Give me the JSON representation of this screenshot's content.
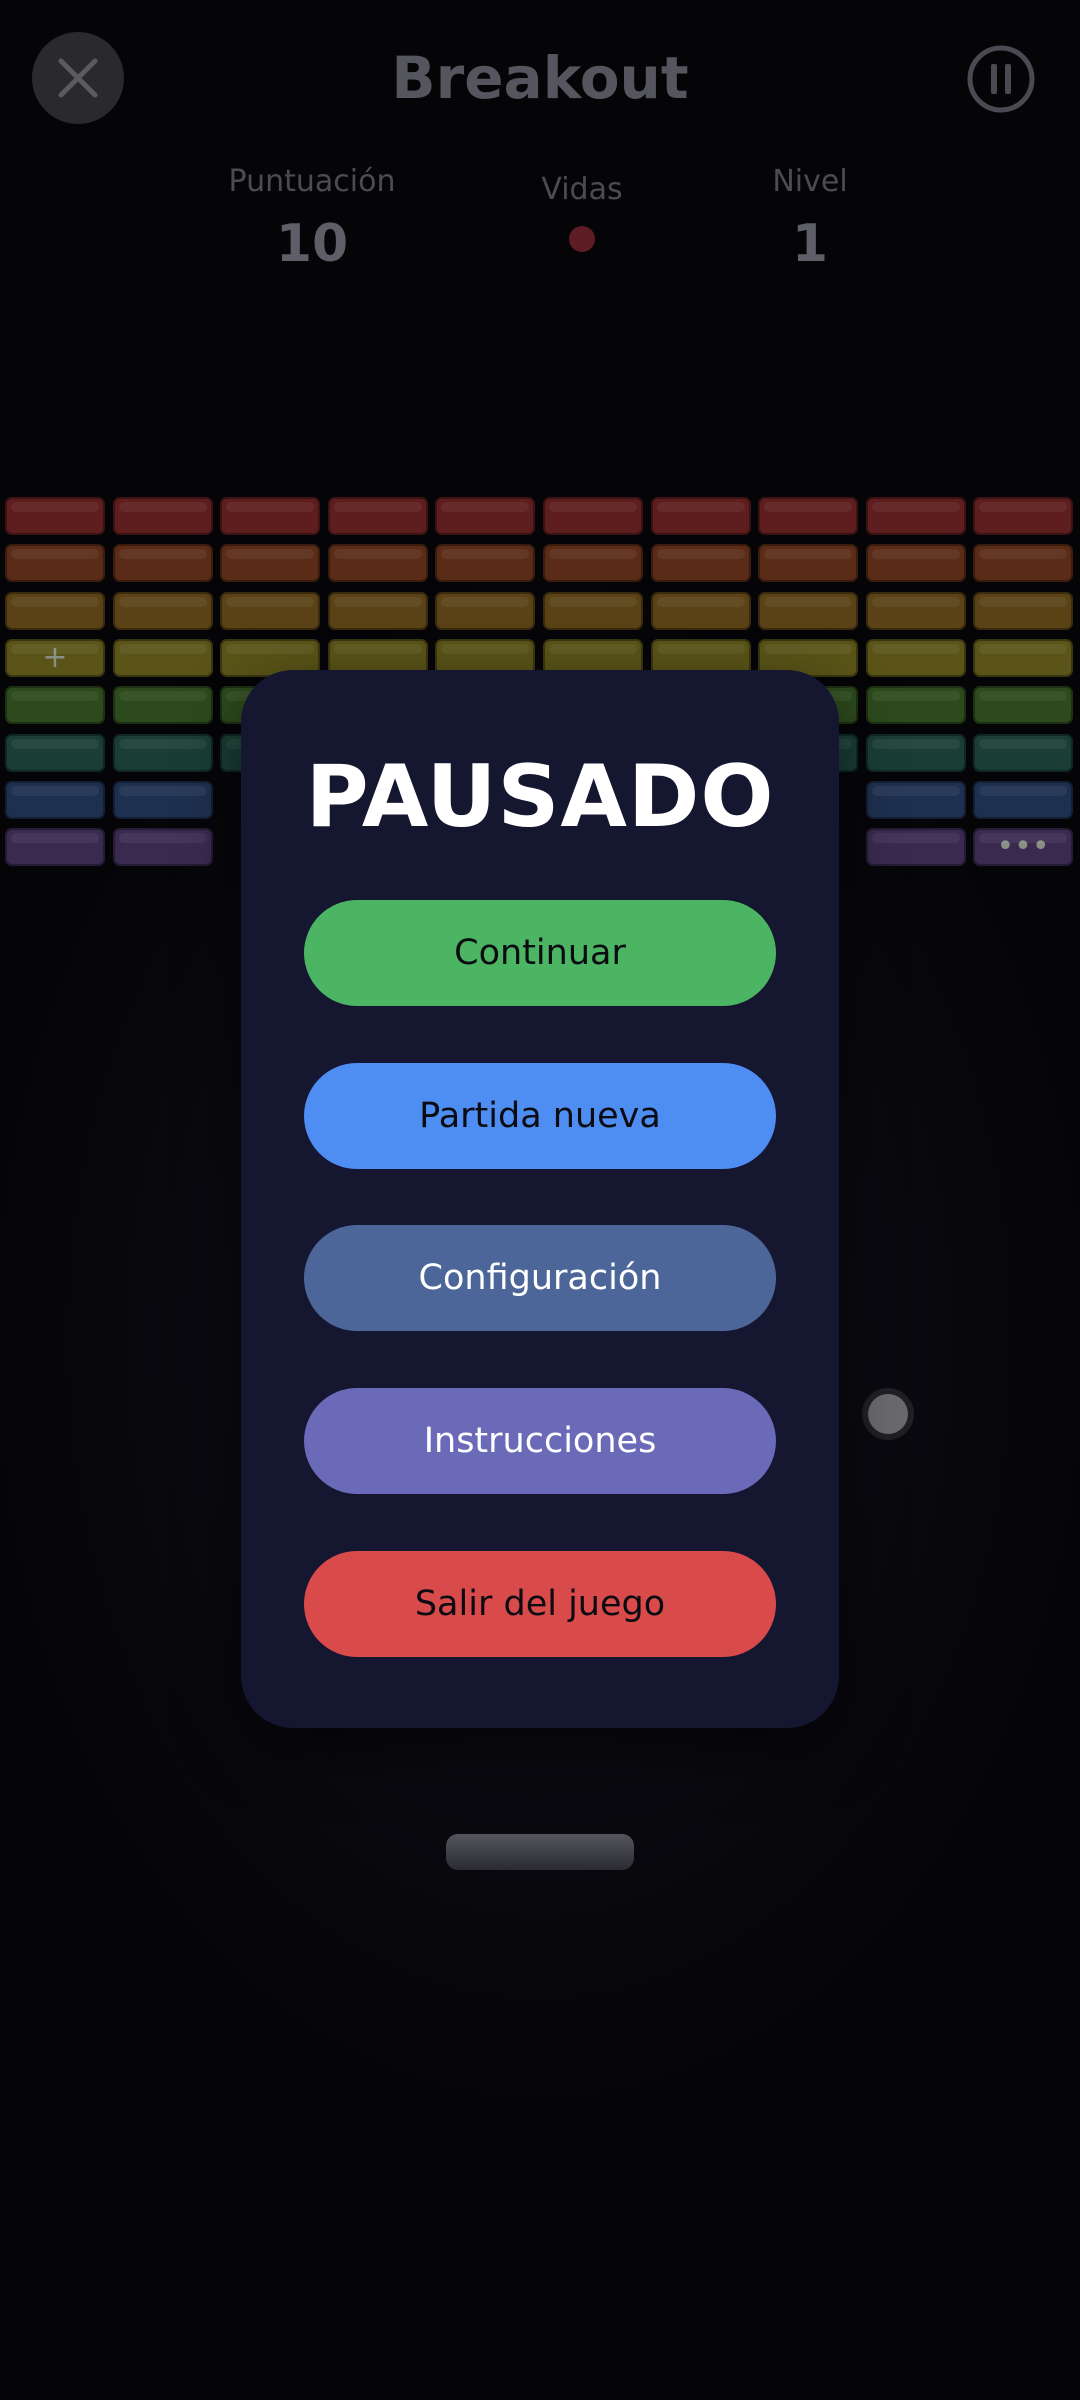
{
  "header": {
    "title": "Breakout",
    "close_icon": "close-icon",
    "pause_icon": "pause-icon"
  },
  "stats": {
    "score_label": "Puntuación",
    "score_value": "10",
    "lives_label": "Vidas",
    "lives_count": 1,
    "level_label": "Nivel",
    "level_value": "1"
  },
  "bricks": {
    "row_colors": [
      "#5e1d1e",
      "#5a2c18",
      "#5a4216",
      "#5a5418",
      "#2c4a1c",
      "#1a3e34",
      "#1e3050",
      "#3a2a50"
    ],
    "missing": [
      [
        6,
        2
      ],
      [
        6,
        3
      ],
      [
        6,
        4
      ],
      [
        6,
        5
      ],
      [
        6,
        6
      ],
      [
        6,
        7
      ],
      [
        7,
        2
      ],
      [
        7,
        3
      ],
      [
        7,
        4
      ],
      [
        7,
        5
      ],
      [
        7,
        6
      ],
      [
        7,
        7
      ]
    ],
    "powerups": [
      {
        "row": 3,
        "col": 0,
        "symbol": "+"
      },
      {
        "row": 7,
        "col": 9,
        "symbol": "•••"
      }
    ]
  },
  "modal": {
    "title": "PAUSADO",
    "buttons": [
      {
        "label": "Continuar",
        "color": "#4cb564",
        "text_color": "#0b0b12"
      },
      {
        "label": "Partida nueva",
        "color": "#4e8ef2",
        "text_color": "#0b0b12"
      },
      {
        "label": "Configuración",
        "color": "#4d6699",
        "text_color": "#ffffff"
      },
      {
        "label": "Instrucciones",
        "color": "#6a6ab8",
        "text_color": "#ffffff"
      },
      {
        "label": "Salir del juego",
        "color": "#d94b4b",
        "text_color": "#0b0b12"
      }
    ]
  },
  "colors": {
    "modal_bg": "#151630",
    "background": "#050508"
  }
}
